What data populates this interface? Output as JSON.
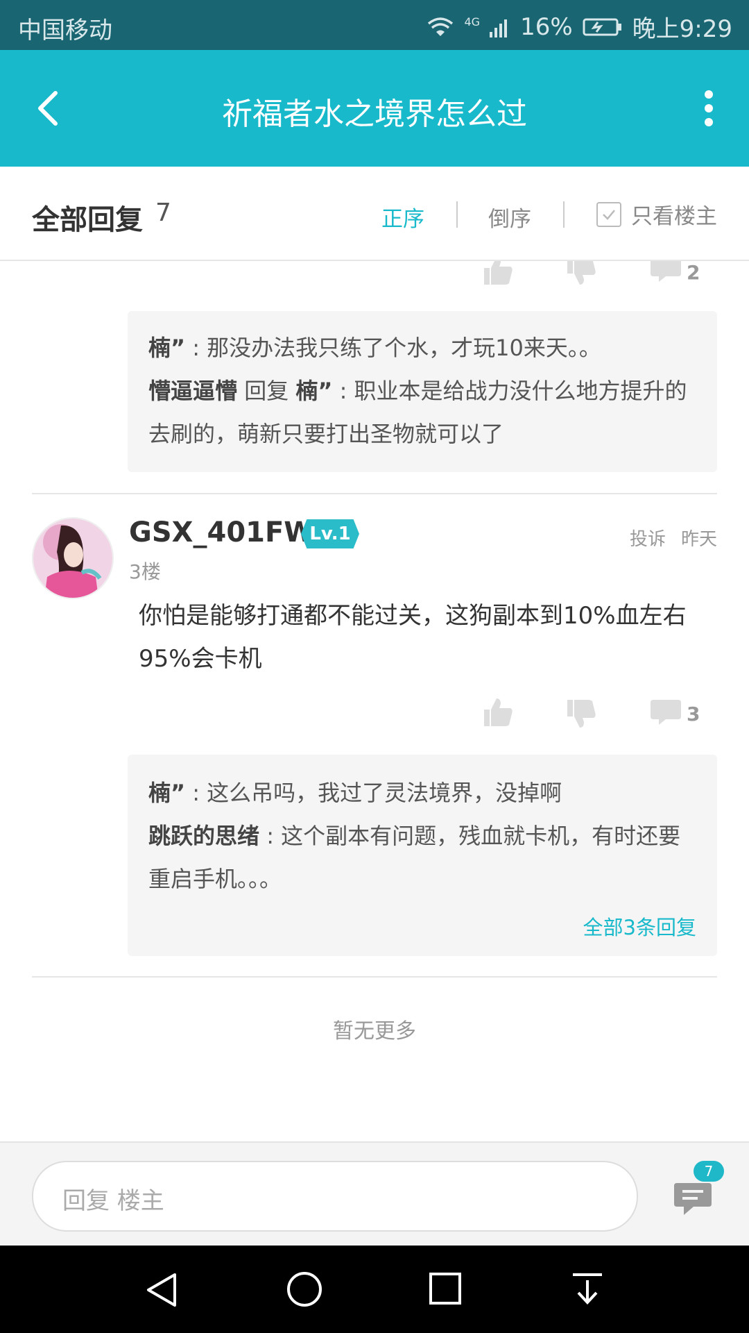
{
  "status_bar": {
    "carrier": "中国移动",
    "network": "4G",
    "battery": "16%",
    "time": "晚上9:29"
  },
  "app_bar": {
    "title": "祈福者水之境界怎么过"
  },
  "reply_header": {
    "title": "全部回复",
    "count": "7",
    "sort_asc": "正序",
    "sort_desc": "倒序",
    "owner_only": "只看楼主"
  },
  "prev_post": {
    "comment_count": "2",
    "replies": [
      {
        "user": "楠”",
        "text": " : 那没办法我只练了个水，才玩10来天。。"
      },
      {
        "user": "懵逼逼懵",
        "reply_word": " 回复 ",
        "target": "楠”",
        "text": " : 职业本是给战力没什么地方提升的去刷的，萌新只要打出圣物就可以了"
      }
    ]
  },
  "post": {
    "username": "GSX_401FW",
    "level": "Lv.1",
    "floor": "3楼",
    "report": "投诉",
    "time": "昨天",
    "content": "你怕是能够打通都不能过关，这狗副本到10%血左右95%会卡机",
    "comment_count": "3",
    "replies": [
      {
        "user": "楠”",
        "text": " : 这么吊吗，我过了灵法境界，没掉啊"
      },
      {
        "user": "跳跃的思绪",
        "text": " : 这个副本有问题，残血就卡机，有时还要重启手机。。。"
      }
    ],
    "all_replies": "全部3条回复"
  },
  "no_more": "暂无更多",
  "bottom": {
    "placeholder": "回复  楼主",
    "badge": "7"
  },
  "colors": {
    "accent": "#17b9cb",
    "statusbar": "#1a6572"
  }
}
